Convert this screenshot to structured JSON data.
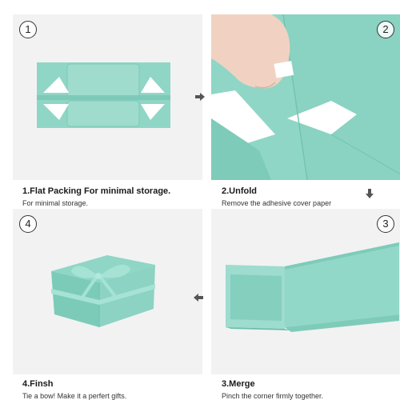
{
  "steps": [
    {
      "num": "1",
      "title": "1.Flat Packing For minimal storage.",
      "subtitle": "For minimal storage."
    },
    {
      "num": "2",
      "title": "2.Unfold",
      "subtitle": "Remove the adhesive cover paper"
    },
    {
      "num": "3",
      "title": "3.Merge",
      "subtitle": "Pinch the corner firmly together."
    },
    {
      "num": "4",
      "title": "4.Finsh",
      "subtitle": "Tie a bow! Make it a perfert gifts."
    }
  ],
  "colors": {
    "box": "#8fd6c6",
    "box_dark": "#6cc2ae",
    "ribbon": "#a6e3d4",
    "panel_bg": "#f2f2f2",
    "arrow": "#555555"
  },
  "icons": {
    "arrows": [
      "arrow-right-icon",
      "arrow-down-icon",
      "arrow-left-icon"
    ]
  }
}
